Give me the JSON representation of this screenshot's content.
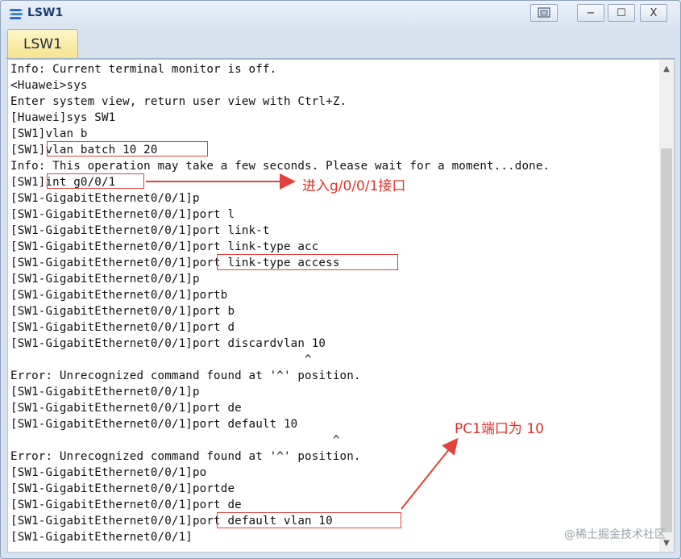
{
  "window": {
    "title": "LSW1",
    "buttons": {
      "restore_icon": "restore-icon",
      "minimize": "−",
      "maximize": "☐",
      "close": "X"
    }
  },
  "tabs": [
    {
      "label": "LSW1",
      "active": true
    }
  ],
  "terminal": {
    "lines": [
      "Info: Current terminal monitor is off.",
      "<Huawei>sys",
      "Enter system view, return user view with Ctrl+Z.",
      "[Huawei]sys SW1",
      "[SW1]vlan b",
      "[SW1]vlan batch 10 20",
      "Info: This operation may take a few seconds. Please wait for a moment...done.",
      "[SW1]int g0/0/1",
      "[SW1-GigabitEthernet0/0/1]p",
      "[SW1-GigabitEthernet0/0/1]port l",
      "[SW1-GigabitEthernet0/0/1]port link-t",
      "[SW1-GigabitEthernet0/0/1]port link-type acc",
      "[SW1-GigabitEthernet0/0/1]port link-type access",
      "[SW1-GigabitEthernet0/0/1]p",
      "[SW1-GigabitEthernet0/0/1]portb",
      "[SW1-GigabitEthernet0/0/1]port b",
      "[SW1-GigabitEthernet0/0/1]port d",
      "[SW1-GigabitEthernet0/0/1]port discardvlan 10",
      "                                          ^",
      "Error: Unrecognized command found at '^' position.",
      "[SW1-GigabitEthernet0/0/1]p",
      "[SW1-GigabitEthernet0/0/1]port de",
      "[SW1-GigabitEthernet0/0/1]port default 10",
      "                                              ^",
      "Error: Unrecognized command found at '^' position.",
      "[SW1-GigabitEthernet0/0/1]po",
      "[SW1-GigabitEthernet0/0/1]portde",
      "[SW1-GigabitEthernet0/0/1]port de",
      "[SW1-GigabitEthernet0/0/1]port default vlan 10",
      "[SW1-GigabitEthernet0/0/1]"
    ]
  },
  "annotations": {
    "interface_note": "进入g/0/0/1接口",
    "pc1_note": "PC1端口为  10",
    "color": "#e3413a"
  },
  "watermark": "@稀土掘金技术社区"
}
